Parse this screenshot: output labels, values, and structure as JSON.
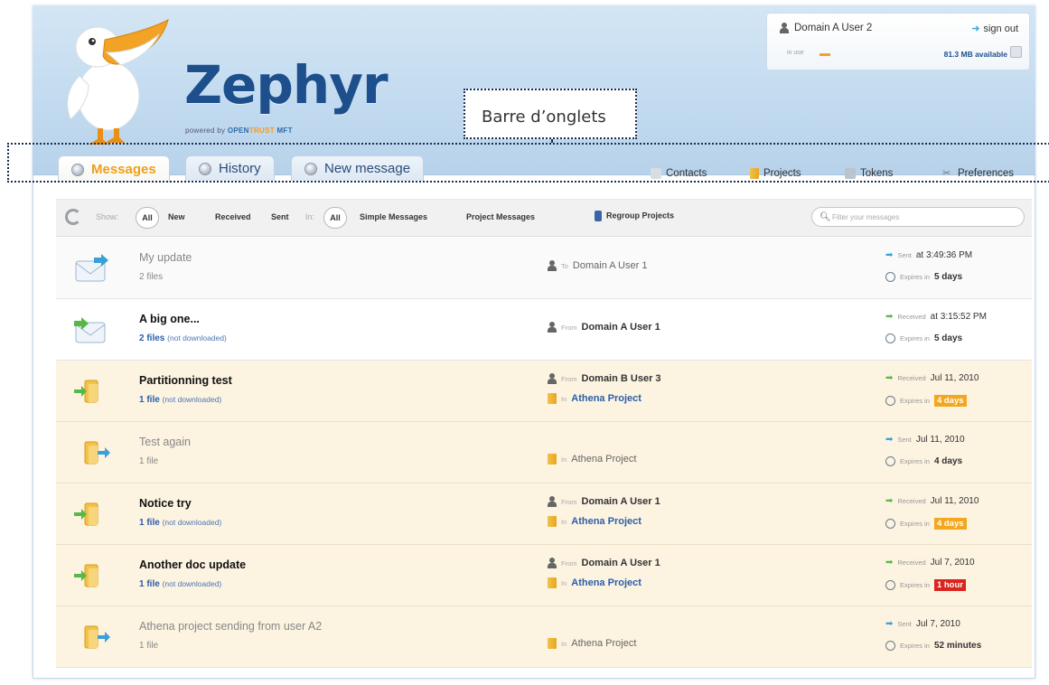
{
  "colors": {
    "brand_blue": "#1e4f8d",
    "accent_orange": "#f0a017",
    "link_blue": "#2a5fa8",
    "row_highlight": "#fcf3e1",
    "badge_warning": "#f3a61e",
    "badge_critical": "#d9251f",
    "sent_arrow": "#3aa0d8",
    "received_arrow": "#58b847"
  },
  "header": {
    "logo_text": "Zephyr",
    "powered_by": "powered by",
    "powered_brand_1": "OPEN",
    "powered_brand_2": "TRUST",
    "powered_brand_3": "MFT",
    "annotation": "Barre d’onglets"
  },
  "user": {
    "name": "Domain A User 2",
    "sign_out": "sign out",
    "quota_label": "in use",
    "available": "81.3 MB available",
    "quota_fraction": 0.05
  },
  "tabs": [
    {
      "label": "Messages",
      "icon": "messages-icon",
      "active": true
    },
    {
      "label": "History",
      "icon": "history-icon",
      "active": false
    },
    {
      "label": "New message",
      "icon": "new-message-icon",
      "active": false
    }
  ],
  "right_links": [
    {
      "label": "Contacts",
      "icon": "contacts-icon"
    },
    {
      "label": "Projects",
      "icon": "projects-icon"
    },
    {
      "label": "Tokens",
      "icon": "tokens-icon"
    },
    {
      "label": "Preferences",
      "icon": "preferences-icon"
    }
  ],
  "filters": {
    "show_label": "Show:",
    "show_all": "All",
    "new": "New",
    "received": "Received",
    "sent": "Sent",
    "in_label": "In:",
    "in_all": "All",
    "simple": "Simple Messages",
    "project": "Project Messages",
    "regroup": "Regroup Projects",
    "search_placeholder": "Filter your messages"
  },
  "messages": [
    {
      "title": "My update",
      "files": "2 files",
      "files_extra": "",
      "read": true,
      "style": "light",
      "icon": "sent-message-icon",
      "who_prefix": "To",
      "who_name": "Domain A User 1",
      "project_prefix": "",
      "project": "",
      "date_prefix": "Sent",
      "date": "at 3:49:36 PM",
      "direction": "sent",
      "expires_prefix": "Expires in",
      "expires": "5 days",
      "badge": ""
    },
    {
      "title": "A big one...",
      "files": "2 files",
      "files_extra": "(not downloaded)",
      "read": false,
      "style": "white",
      "icon": "received-message-icon",
      "who_prefix": "From",
      "who_name": "Domain A User 1",
      "project_prefix": "",
      "project": "",
      "date_prefix": "Received",
      "date": "at 3:15:52 PM",
      "direction": "received",
      "expires_prefix": "Expires in",
      "expires": "5 days",
      "badge": ""
    },
    {
      "title": "Partitionning test",
      "files": "1 file",
      "files_extra": "(not downloaded)",
      "read": false,
      "style": "cream",
      "icon": "received-project-icon",
      "who_prefix": "From",
      "who_name": "Domain B User 3",
      "project_prefix": "In",
      "project": "Athena Project",
      "date_prefix": "Received",
      "date": "Jul 11, 2010",
      "direction": "received",
      "expires_prefix": "Expires in",
      "expires": "4 days",
      "badge": "warning"
    },
    {
      "title": "Test again",
      "files": "1 file",
      "files_extra": "",
      "read": true,
      "style": "cream",
      "icon": "sent-project-icon",
      "who_prefix": "",
      "who_name": "",
      "project_prefix": "In",
      "project": "Athena Project",
      "date_prefix": "Sent",
      "date": "Jul 11, 2010",
      "direction": "sent",
      "expires_prefix": "Expires in",
      "expires": "4 days",
      "badge": ""
    },
    {
      "title": "Notice try",
      "files": "1 file",
      "files_extra": "(not downloaded)",
      "read": false,
      "style": "cream",
      "icon": "received-project-icon",
      "who_prefix": "From",
      "who_name": "Domain A User 1",
      "project_prefix": "In",
      "project": "Athena Project",
      "date_prefix": "Received",
      "date": "Jul 11, 2010",
      "direction": "received",
      "expires_prefix": "Expires in",
      "expires": "4 days",
      "badge": "warning"
    },
    {
      "title": "Another doc update",
      "files": "1 file",
      "files_extra": "(not downloaded)",
      "read": false,
      "style": "cream",
      "icon": "received-project-icon",
      "who_prefix": "From",
      "who_name": "Domain A User 1",
      "project_prefix": "In",
      "project": "Athena Project",
      "date_prefix": "Received",
      "date": "Jul 7, 2010",
      "direction": "received",
      "expires_prefix": "Expires in",
      "expires": "1 hour",
      "badge": "critical"
    },
    {
      "title": "Athena project sending from user A2",
      "files": "1 file",
      "files_extra": "",
      "read": true,
      "style": "cream",
      "icon": "sent-project-icon",
      "who_prefix": "",
      "who_name": "",
      "project_prefix": "In",
      "project": "Athena Project",
      "date_prefix": "Sent",
      "date": "Jul 7, 2010",
      "direction": "sent",
      "expires_prefix": "Expires in",
      "expires": "52 minutes",
      "badge": ""
    }
  ]
}
